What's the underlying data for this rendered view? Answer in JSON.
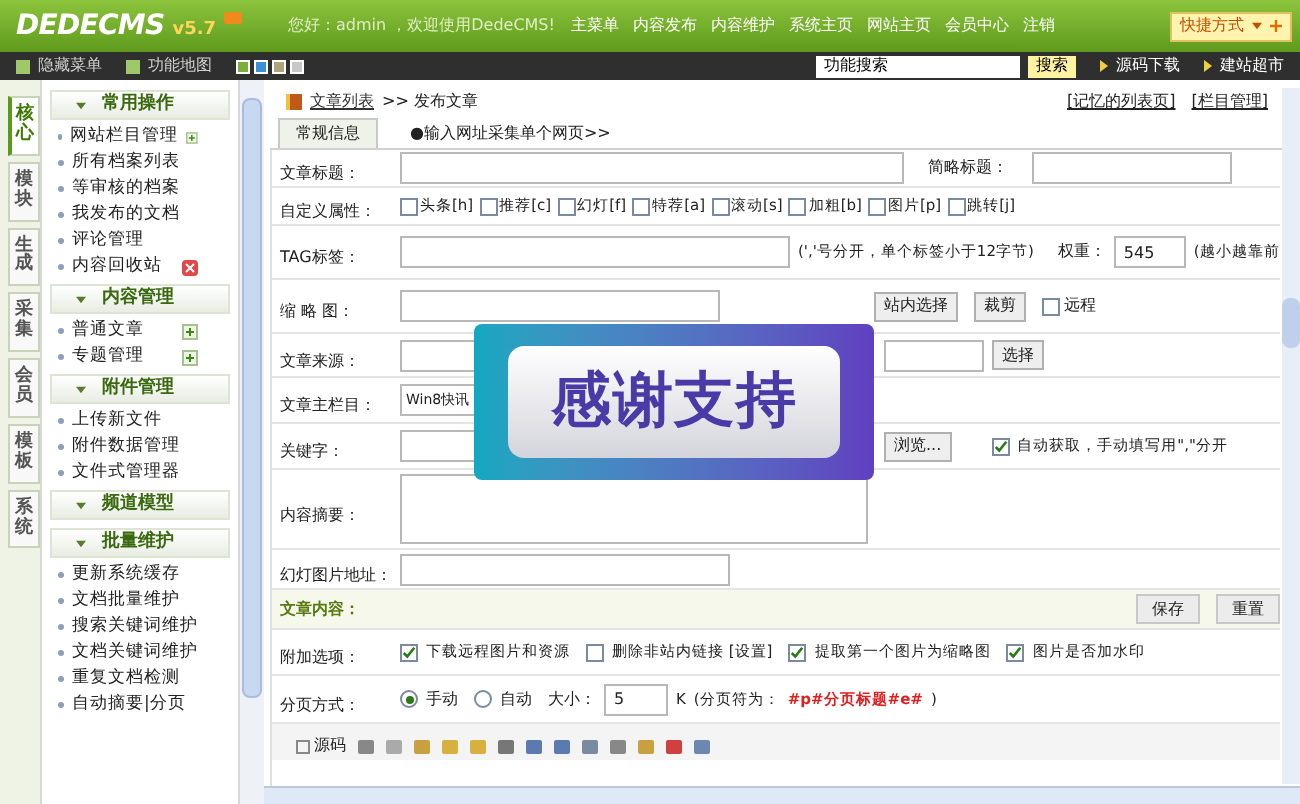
{
  "header": {
    "logo": "DEDECMS",
    "version": "v5.7",
    "greeting": "您好：admin ，欢迎使用DedeCMS!",
    "nav": [
      "主菜单",
      "内容发布",
      "内容维护",
      "系统主页",
      "网站主页",
      "会员中心",
      "注销"
    ],
    "quick": "快捷方式"
  },
  "toolbar": {
    "hide_menu": "隐藏菜单",
    "map": "功能地图",
    "search_value": "功能搜索",
    "search_button": "搜索",
    "links": [
      "源码下载",
      "建站超市"
    ]
  },
  "side_tabs": [
    {
      "label": "核心",
      "selected": true
    },
    {
      "label": "模块",
      "selected": false
    },
    {
      "label": "生成",
      "selected": false
    },
    {
      "label": "采集",
      "selected": false
    },
    {
      "label": "会员",
      "selected": false
    },
    {
      "label": "模板",
      "selected": false
    },
    {
      "label": "系统",
      "selected": false
    }
  ],
  "sidebar": [
    {
      "title": "常用操作",
      "items": [
        {
          "label": "网站栏目管理",
          "kind": "add"
        },
        {
          "label": "所有档案列表",
          "kind": "link"
        },
        {
          "label": "等审核的档案",
          "kind": "link"
        },
        {
          "label": "我发布的文档",
          "kind": "link"
        },
        {
          "label": "评论管理",
          "kind": "link"
        },
        {
          "label": "内容回收站",
          "kind": "delete"
        }
      ]
    },
    {
      "title": "内容管理",
      "items": [
        {
          "label": "普通文章",
          "kind": "add"
        },
        {
          "label": "专题管理",
          "kind": "add"
        }
      ]
    },
    {
      "title": "附件管理",
      "items": [
        {
          "label": "上传新文件",
          "kind": "link"
        },
        {
          "label": "附件数据管理",
          "kind": "link"
        },
        {
          "label": "文件式管理器",
          "kind": "link"
        }
      ]
    },
    {
      "title": "频道模型"
    },
    {
      "title": "批量维护",
      "items": [
        {
          "label": "更新系统缓存",
          "kind": "link"
        },
        {
          "label": "文档批量维护",
          "kind": "link"
        },
        {
          "label": "搜索关键词维护",
          "kind": "link"
        },
        {
          "label": "文档关键词维护",
          "kind": "link"
        },
        {
          "label": "重复文档检测",
          "kind": "link"
        },
        {
          "label": "自动摘要|分页",
          "kind": "link"
        }
      ]
    }
  ],
  "breadcrumb": {
    "link": "文章列表",
    "current": ">> 发布文章",
    "right_links": [
      "[记忆的列表页]",
      "[栏目管理]"
    ]
  },
  "tabs": [
    {
      "label": "常规信息",
      "selected": true
    },
    {
      "label": "●输入网址采集单个网页>>",
      "selected": false
    }
  ],
  "form": {
    "title_label": "文章标题：",
    "short_title_label": "简略标题：",
    "attrs_label": "自定义属性：",
    "attrs": [
      {
        "label": "头条[h]",
        "checked": false
      },
      {
        "label": "推荐[c]",
        "checked": false
      },
      {
        "label": "幻灯[f]",
        "checked": false
      },
      {
        "label": "特荐[a]",
        "checked": false
      },
      {
        "label": "滚动[s]",
        "checked": false
      },
      {
        "label": "加粗[b]",
        "checked": false
      },
      {
        "label": "图片[p]",
        "checked": false
      },
      {
        "label": "跳转[j]",
        "checked": false
      }
    ],
    "tag_label": "TAG标签：",
    "tag_hint": "(','号分开，单个标签小于12字节)",
    "weight_label": "权重：",
    "weight_value": "545",
    "weight_hint": "(越小越靠前",
    "thumb_label": "缩 略 图：",
    "thumb_buttons": [
      "站内选择",
      "裁剪"
    ],
    "remote": {
      "label": "远程",
      "checked": false
    },
    "source_label": "文章来源：",
    "source_button": "选择",
    "column_label": "文章主栏目：",
    "column_value": "Win8快讯",
    "keywords_label": "关键字：",
    "browse_button": "浏览...",
    "auto_keywords": {
      "label": "自动获取，手动填写用\",\"分开",
      "checked": true
    },
    "summary_label": "内容摘要：",
    "slide_label": "幻灯图片地址："
  },
  "content": {
    "title": "文章内容：",
    "buttons": [
      "保存",
      "重置"
    ],
    "options_label": "附加选项：",
    "options": [
      {
        "label": "下载远程图片和资源",
        "checked": true
      },
      {
        "label": "删除非站内链接 [设置]",
        "checked": false
      },
      {
        "label": "提取第一个图片为缩略图",
        "checked": true
      },
      {
        "label": "图片是否加水印",
        "checked": true
      }
    ],
    "paging_label": "分页方式：",
    "paging_modes": [
      {
        "label": "手动",
        "selected": true
      },
      {
        "label": "自动",
        "selected": false
      }
    ],
    "size_label": "大小：",
    "size_value": "5",
    "size_unit": "K",
    "separator_prefix": "(分页符为：",
    "separator": "#p#分页标题#e#",
    "separator_suffix": ")",
    "source_button": "源码"
  },
  "overlay": "感谢支持"
}
